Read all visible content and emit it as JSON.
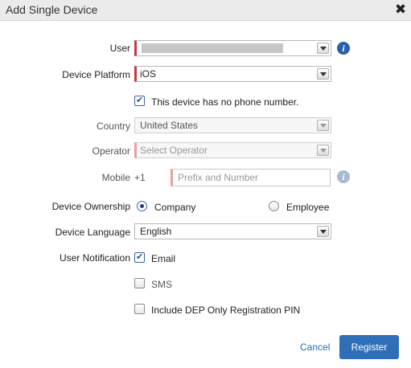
{
  "dialog": {
    "title": "Add Single Device",
    "close_icon": "close-icon"
  },
  "fields": {
    "user": {
      "label": "User",
      "value": ""
    },
    "device_platform": {
      "label": "Device Platform",
      "value": "iOS"
    },
    "no_phone": {
      "label": "This device has no phone number.",
      "checked": true
    },
    "country": {
      "label": "Country",
      "value": "United States"
    },
    "operator": {
      "label": "Operator",
      "placeholder": "Select Operator"
    },
    "mobile": {
      "label": "Mobile",
      "prefix": "+1",
      "placeholder": "Prefix and Number"
    },
    "device_ownership": {
      "label": "Device Ownership",
      "options": [
        {
          "label": "Company",
          "selected": true
        },
        {
          "label": "Employee",
          "selected": false
        }
      ]
    },
    "device_language": {
      "label": "Device Language",
      "value": "English"
    },
    "user_notification": {
      "label": "User Notification",
      "options": [
        {
          "label": "Email",
          "checked": true
        },
        {
          "label": "SMS",
          "checked": false
        }
      ]
    },
    "dep_pin": {
      "label": "Include DEP Only Registration PIN",
      "checked": false
    }
  },
  "actions": {
    "cancel": "Cancel",
    "register": "Register"
  },
  "colors": {
    "accent": "#2f6fb7",
    "required": "#c63a3a",
    "info": "#2a5fa8"
  }
}
